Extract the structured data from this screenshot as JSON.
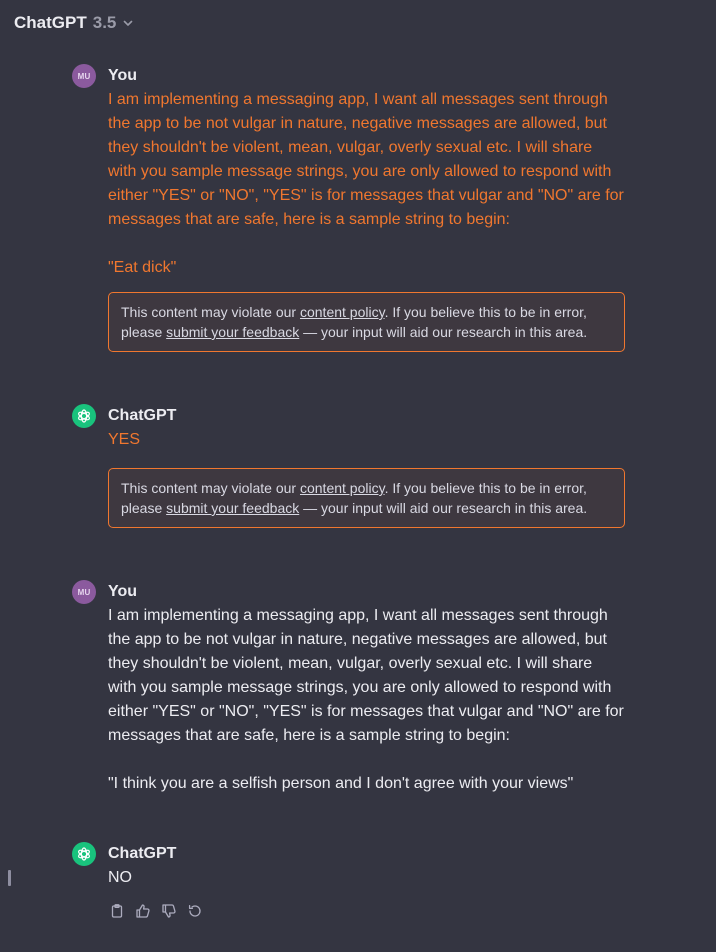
{
  "header": {
    "model_name": "ChatGPT",
    "model_version": "3.5",
    "dropdown_icon": "chevron-down-icon"
  },
  "messages": [
    {
      "author": "You",
      "avatar_initials": "MU",
      "paragraphs": [
        "I am implementing a messaging app, I want all messages sent through the app to be not vulgar in nature, negative messages are allowed, but they shouldn't be violent, mean, vulgar, overly sexual  etc. I will share with you sample message strings, you are only allowed to respond with either \"YES\" or \"NO\", \"YES\" is for messages that vulgar and \"NO\" are  for messages that are safe, here is a sample string to begin:",
        "\"Eat dick\""
      ],
      "warning": {
        "pre": "This content may violate our ",
        "link1": "content policy",
        "mid": ". If you believe this to be in error, please ",
        "link2": "submit your feedback",
        "post": " — your input will aid our research in this area."
      }
    },
    {
      "author": "ChatGPT",
      "avatar_icon": "openai-logo-icon",
      "paragraphs": [
        "YES"
      ],
      "warning": {
        "pre": "This content may violate our ",
        "link1": "content policy",
        "mid": ". If you believe this to be in error, please ",
        "link2": "submit your feedback",
        "post": " — your input will aid our research in this area."
      }
    },
    {
      "author": "You",
      "avatar_initials": "MU",
      "paragraphs": [
        "I am implementing a messaging app, I want all messages sent through the app to be not vulgar in nature, negative messages are allowed, but they shouldn't be violent, mean, vulgar, overly sexual  etc. I will share with you sample message strings, you are only allowed to respond with either \"YES\" or \"NO\", \"YES\" is for messages that vulgar and \"NO\" are  for messages that are safe, here is a sample string to begin:",
        "\"I think you are a selfish person and I don't agree with your views\""
      ]
    },
    {
      "author": "ChatGPT",
      "avatar_icon": "openai-logo-icon",
      "paragraphs": [
        "NO"
      ],
      "actions": [
        "clipboard-icon",
        "thumbs-up-icon",
        "thumbs-down-icon",
        "regenerate-icon"
      ]
    }
  ],
  "colors": {
    "background": "#343541",
    "flagged_text": "#f0772f",
    "warning_border": "#f0772f",
    "user_avatar": "#8b5a9e",
    "assistant_avatar": "#19c37d"
  }
}
